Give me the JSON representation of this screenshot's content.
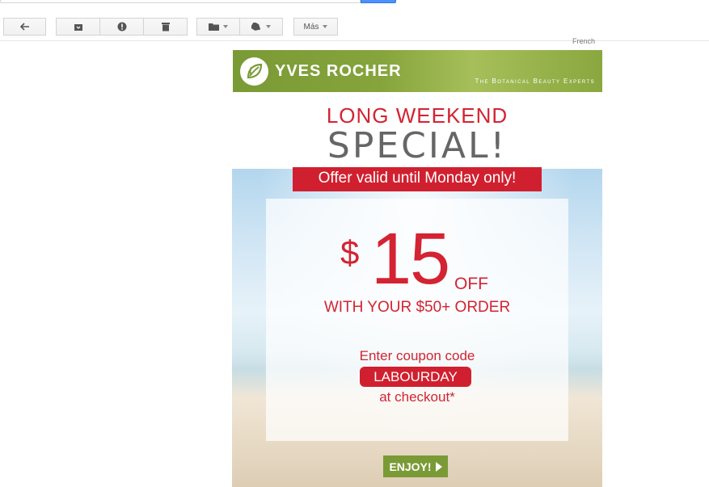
{
  "toolbar": {
    "more_label": "Más"
  },
  "header_fragment": "French",
  "email": {
    "brand": "YVES ROCHER",
    "tagline": "The Botanical Beauty Experts",
    "headline_1": "LONG WEEKEND",
    "headline_2": "SPECIAL!",
    "offer_banner": "Offer valid until Monday only!",
    "currency": "$",
    "discount": "15",
    "off": "OFF",
    "order_line": "WITH YOUR $50+ ORDER",
    "enter_code": "Enter  coupon code",
    "coupon_code": "LABOURDAY",
    "at_checkout": "at checkout*",
    "cta_label": "ENJOY!"
  },
  "colors": {
    "brand_green": "#7a9a35",
    "accent_red": "#d42332",
    "gmail_blue": "#4d90fe"
  },
  "icons": [
    "reply-icon",
    "archive-icon",
    "report-spam-icon",
    "delete-icon",
    "folder-icon",
    "label-icon",
    "yves-rocher-leaf-logo",
    "play-arrow-icon"
  ]
}
